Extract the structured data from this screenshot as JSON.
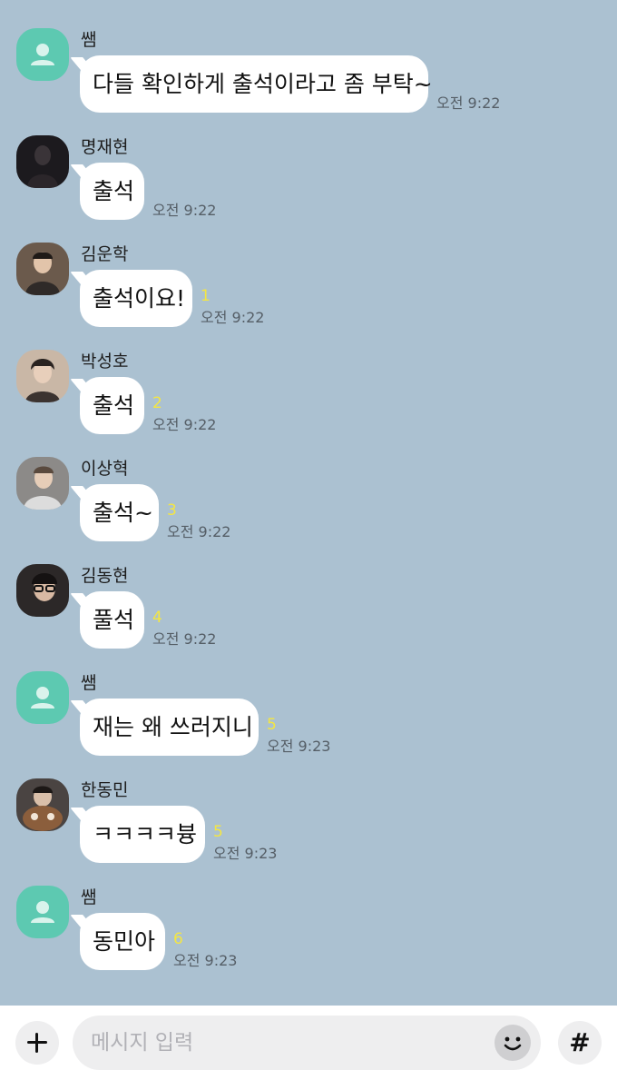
{
  "messages": [
    {
      "sender": "쌤",
      "avatar": "default-profile",
      "text": "다들 확인하게 출석이라고 좀 부탁~",
      "unread": "",
      "time": "오전 9:22"
    },
    {
      "sender": "명재현",
      "avatar": "photo",
      "text": "출석",
      "unread": "",
      "time": "오전 9:22"
    },
    {
      "sender": "김운학",
      "avatar": "photo",
      "text": "출석이요!",
      "unread": "1",
      "time": "오전 9:22"
    },
    {
      "sender": "박성호",
      "avatar": "photo",
      "text": "출석",
      "unread": "2",
      "time": "오전 9:22"
    },
    {
      "sender": "이상혁",
      "avatar": "photo",
      "text": "출석~",
      "unread": "3",
      "time": "오전 9:22"
    },
    {
      "sender": "김동현",
      "avatar": "photo",
      "text": "풀석",
      "unread": "4",
      "time": "오전 9:22"
    },
    {
      "sender": "쌤",
      "avatar": "default-profile",
      "text": "재는 왜 쓰러지니",
      "unread": "5",
      "time": "오전 9:23"
    },
    {
      "sender": "한동민",
      "avatar": "photo",
      "text": "ㅋㅋㅋㅋ븅",
      "unread": "5",
      "time": "오전 9:23"
    },
    {
      "sender": "쌤",
      "avatar": "default-profile",
      "text": "동민아",
      "unread": "6",
      "time": "오전 9:23"
    }
  ],
  "input": {
    "placeholder": "메시지 입력",
    "value": ""
  },
  "icons": {
    "attach": "plus-icon",
    "emoji": "emoticon-icon",
    "hashtag": "hash-icon",
    "hashtag_glyph": "#"
  },
  "colors": {
    "chat_background": "#abc1d1",
    "bubble": "#ffffff",
    "unread_count": "#f4e642",
    "default_avatar": "#5dc9b1"
  }
}
